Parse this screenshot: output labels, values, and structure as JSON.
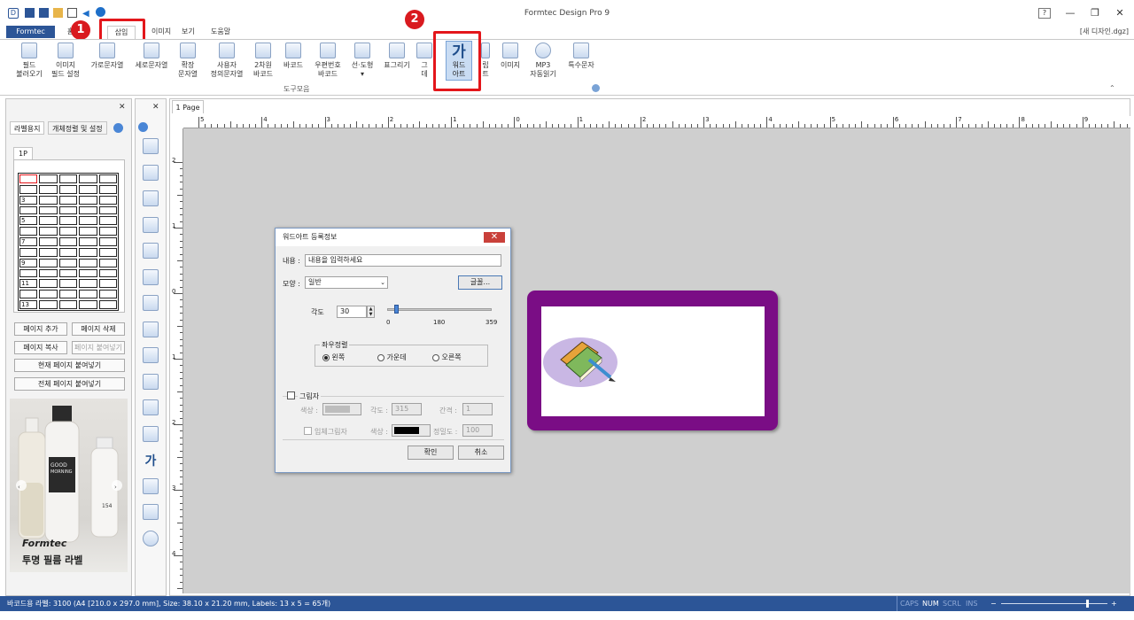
{
  "window": {
    "title": "Formtec Design Pro 9",
    "document_name": "[새 디자인.dgz]",
    "controls": {
      "help": "?",
      "minimize": "—",
      "restore": "❐",
      "close": "✕"
    }
  },
  "tabs": [
    {
      "label": "Formtec"
    },
    {
      "label": "홈"
    },
    {
      "label": "삽입"
    },
    {
      "label": "이미지"
    },
    {
      "label": "보기"
    },
    {
      "label": "도움말"
    }
  ],
  "ribbon": {
    "buttons": [
      {
        "line1": "필드",
        "line2": "불러오기"
      },
      {
        "line1": "이미지",
        "line2": "필드 설정"
      },
      {
        "line1": "가로문자열",
        "line2": ""
      },
      {
        "line1": "세로문자열",
        "line2": ""
      },
      {
        "line1": "확장",
        "line2": "문자열"
      },
      {
        "line1": "사용자",
        "line2": "정의문자열"
      },
      {
        "line1": "2차원",
        "line2": "바코드"
      },
      {
        "line1": "바코드",
        "line2": ""
      },
      {
        "line1": "우편번호",
        "line2": "바코드"
      },
      {
        "line1": "선·도형",
        "line2": "▾"
      },
      {
        "line1": "표그리기",
        "line2": ""
      },
      {
        "line1": "그",
        "line2": "데"
      },
      {
        "line1": "워드",
        "line2": "아트"
      },
      {
        "line1": "립",
        "line2": "트"
      },
      {
        "line1": "이미지",
        "line2": ""
      },
      {
        "line1": "MP3",
        "line2": "자동읽기"
      },
      {
        "line1": "특수문자",
        "line2": ""
      }
    ],
    "group_label": "도구모음",
    "wordart_glyph": "가",
    "callout_1": "1",
    "callout_2": "2"
  },
  "left_panel": {
    "tabs": [
      "라벨용지",
      "개체정렬 및 설정"
    ],
    "page_tab": "1P",
    "row_numbers": [
      "3",
      "5",
      "7",
      "9",
      "11",
      "13"
    ],
    "buttons": {
      "add_page": "페이지 추가",
      "delete_page": "페이지 삭제",
      "copy_page": "페이지 복사",
      "paste_page": "페이지 붙여넣기",
      "paste_current": "현재 페이지 붙여넣기",
      "paste_all": "전체 페이지 붙여넣기"
    },
    "ad": {
      "bottle_text1": "GOOD",
      "bottle_text2": "MORNING",
      "bottle_text3": "154",
      "brand": "Formtec",
      "caption": "투명 필름 라벨"
    }
  },
  "canvas": {
    "page_tab": "1 Page",
    "ruler_h": [
      "5",
      "4",
      "3",
      "2",
      "1",
      "0",
      "1",
      "2",
      "3",
      "4",
      "5",
      "6",
      "7",
      "8",
      "9"
    ],
    "ruler_v": [
      "2",
      "1",
      "0",
      "1",
      "2",
      "3",
      "4"
    ]
  },
  "dialog": {
    "title": "워드아트 등록정보",
    "close": "✕",
    "content_label": "내용 :",
    "content_value": "내용을 입력하세요",
    "shape_label": "모양 :",
    "shape_value": "일반",
    "font_button": "글꼴...",
    "angle_label": "각도",
    "angle_value": "30",
    "slider_min": "0",
    "slider_mid": "180",
    "slider_max": "359",
    "slider_fraction": 0.084,
    "align_group": "좌우정렬",
    "align_left": "왼쪽",
    "align_center": "가운데",
    "align_right": "오른쪽",
    "shadow_label": "그림자",
    "color_label": "색상 :",
    "shadow_angle_label": "각도 :",
    "shadow_angle_value": "315",
    "spacing_label": "간격 :",
    "spacing_value": "1",
    "solid_shadow_label": "입체그림자",
    "solid_color_label": "색상 :",
    "precision_label": "정밀도 :",
    "precision_value": "100",
    "ok": "확인",
    "cancel": "취소"
  },
  "status": {
    "info": "바코드용 라벨: 3100 (A4 [210.0 x 297.0 mm], Size: 38.10 x 21.20 mm,  Labels: 13 x 5 = 65개)",
    "indicators": [
      "CAPS",
      "NUM",
      "SCRL",
      "INS"
    ],
    "zoom_minus": "−",
    "zoom_plus": "+"
  },
  "colors": {
    "accent": "#2c5597",
    "callout_red": "#e3161b",
    "label_border": "#7a0d85",
    "canvas_bg": "#cfcfcf"
  }
}
